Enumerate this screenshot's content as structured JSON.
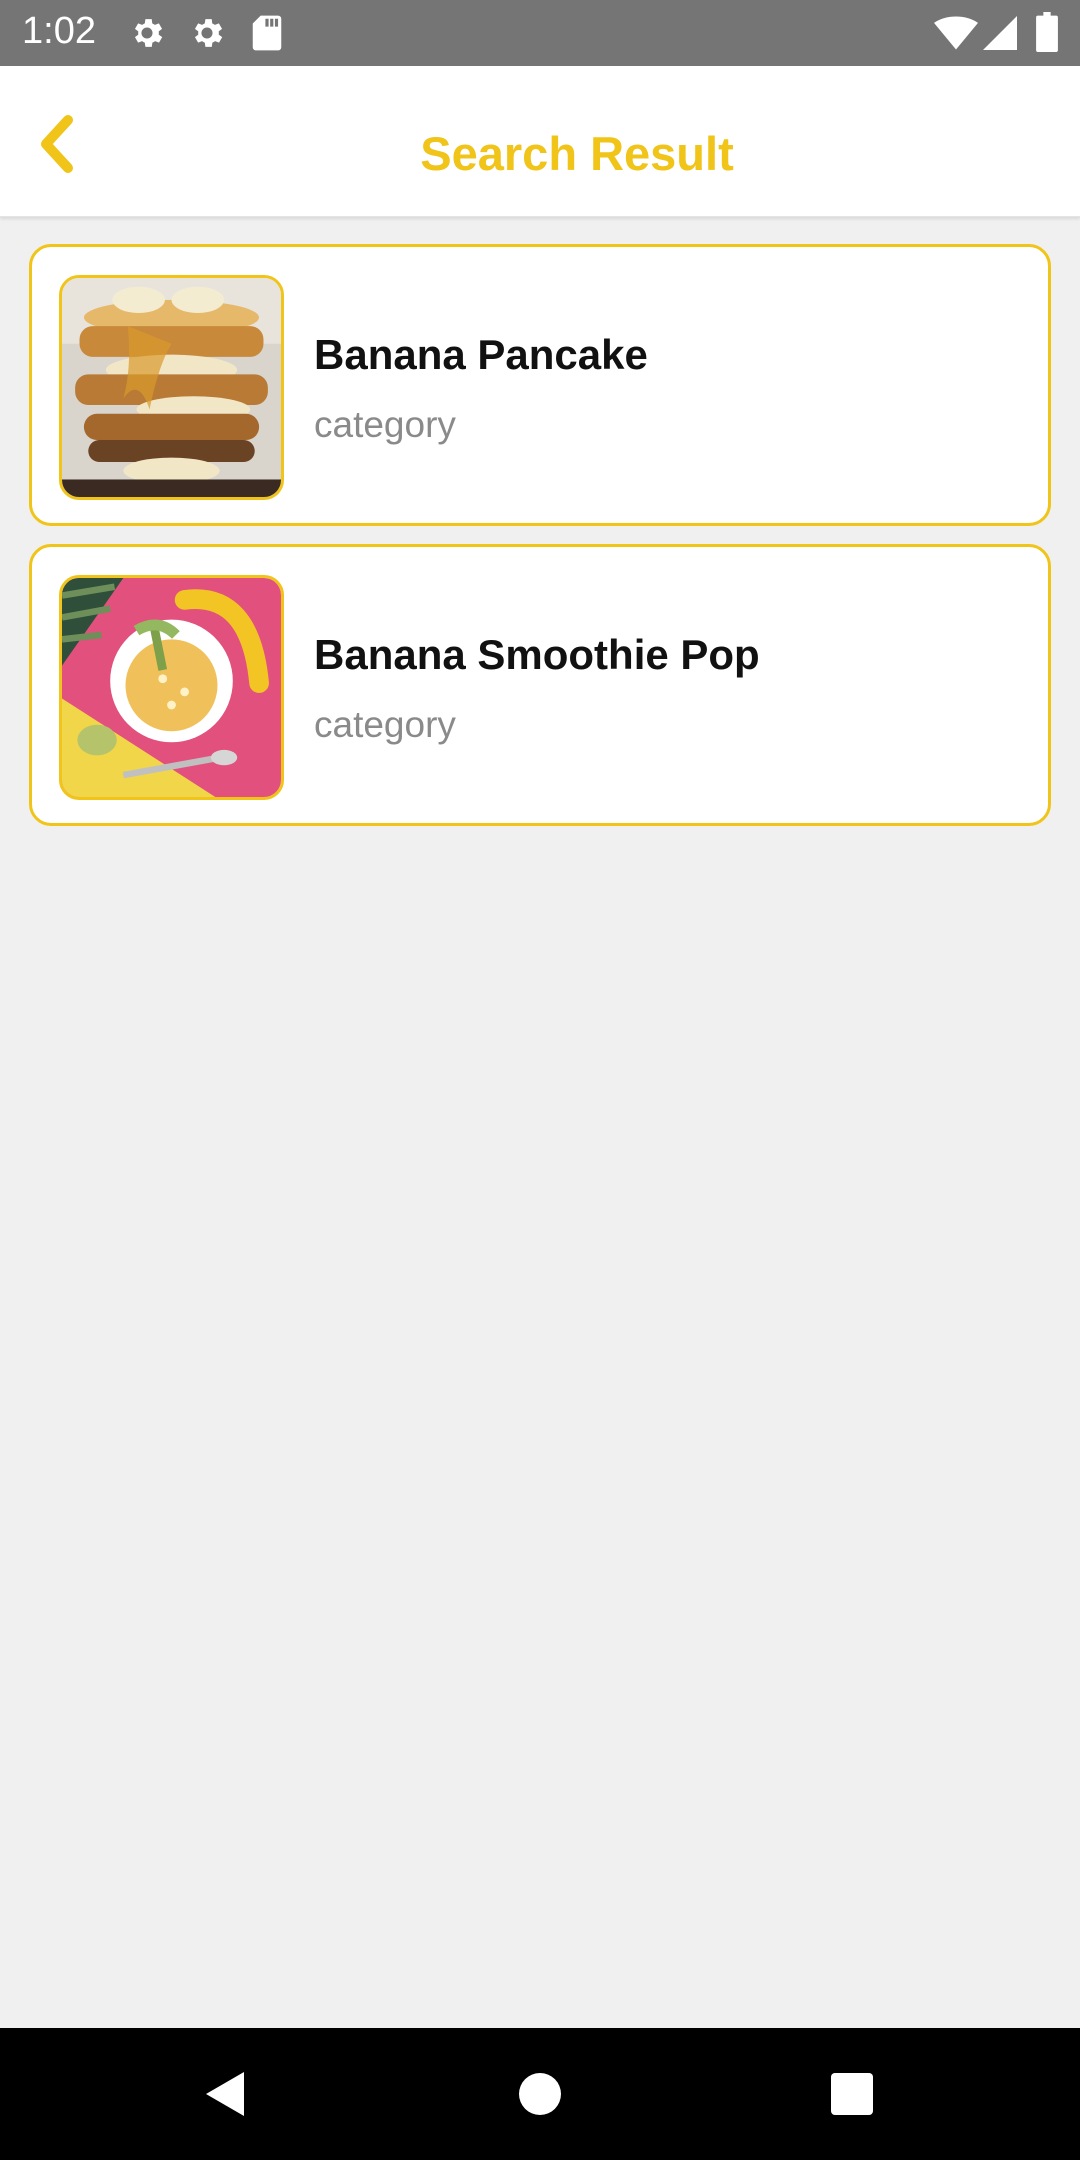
{
  "status_bar": {
    "time": "1:02",
    "icons": [
      "settings-gear-icon",
      "settings-gear-icon",
      "sd-card-icon",
      "wifi-icon",
      "signal-icon",
      "battery-icon"
    ]
  },
  "app_bar": {
    "title": "Search Result",
    "back_icon": "chevron-left-icon",
    "accent_color": "#F0C419"
  },
  "results": [
    {
      "title": "Banana Pancake",
      "subtitle": "category",
      "image": "banana-pancake-photo"
    },
    {
      "title": "Banana Smoothie Pop",
      "subtitle": "category",
      "image": "banana-smoothie-photo"
    }
  ],
  "nav_bar": {
    "buttons": [
      "back-triangle-icon",
      "home-circle-icon",
      "recents-square-icon"
    ]
  }
}
